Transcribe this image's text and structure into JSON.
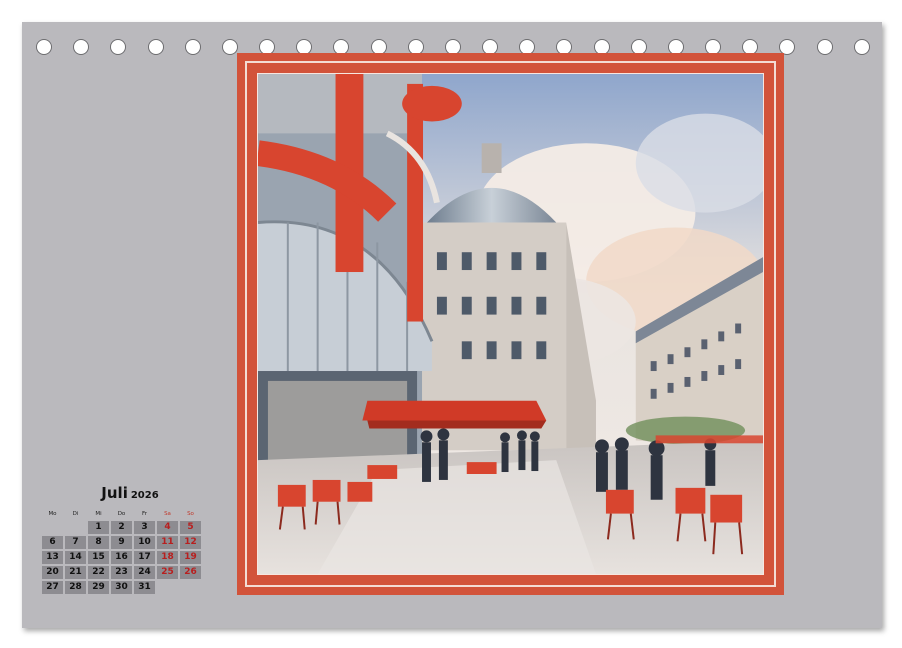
{
  "calendar": {
    "month": "Juli",
    "year": "2026",
    "weekdays": [
      "Mo",
      "Di",
      "Mi",
      "Do",
      "Fr",
      "Sa",
      "So"
    ],
    "leading_blanks": 2,
    "days": [
      "1",
      "2",
      "3",
      "4",
      "5",
      "6",
      "7",
      "8",
      "9",
      "10",
      "11",
      "12",
      "13",
      "14",
      "15",
      "16",
      "17",
      "18",
      "19",
      "20",
      "21",
      "22",
      "23",
      "24",
      "25",
      "26",
      "27",
      "28",
      "29",
      "30",
      "31"
    ]
  },
  "colors": {
    "sheet": "#bab9bd",
    "frame": "#d2533a",
    "weekend_text": "#b81f1f",
    "day_cell": "#8d8c91"
  },
  "binding": {
    "hole_count": 23
  },
  "image": {
    "subject_icon": "watercolor-paris-street-icon"
  }
}
